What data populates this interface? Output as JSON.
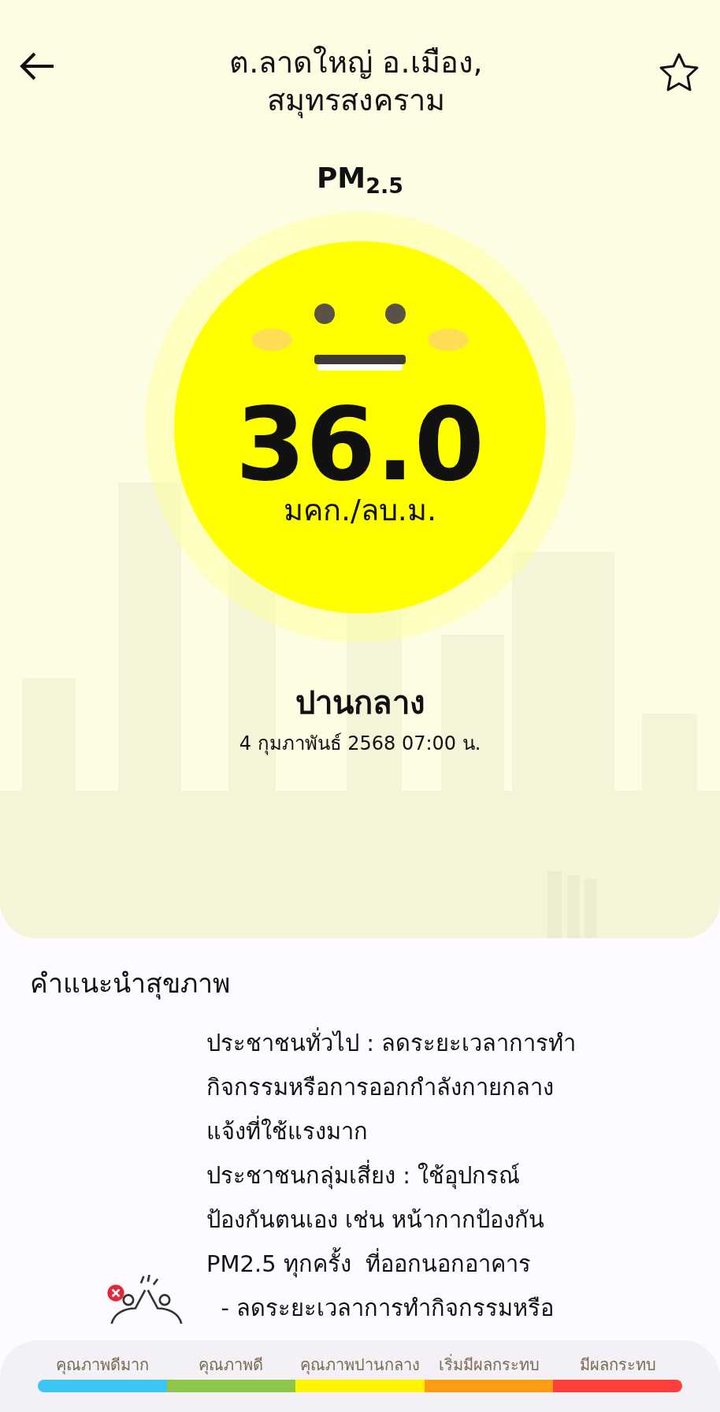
{
  "header": {
    "title_lines": [
      "ต.ลาดใหญ่ อ.เมือง,",
      "สมุทรสงคราม"
    ],
    "favorite": false
  },
  "pollutant": "PM$_{2.5}$",
  "reading": {
    "value": "36.0",
    "unit": "มคก./ลบ.ม.",
    "color": "#ffff00",
    "level_label": "ปานกลาง",
    "datetime": "4 กุมภาพันธ์ 2568  07:00 น."
  },
  "advice": {
    "heading": "คำแนะนำสุขภาพ",
    "paragraphs": [
      {
        "lines": [
          "ประชาชนทั่วไป : ลดระยะเวลาการทำ",
          "กิจกรรมหรือการออกกำลังกายกลาง",
          "แจ้งที่ใช้แรงมาก"
        ]
      },
      {
        "lines": [
          "ประชาชนกลุ่มเสี่ยง : ใช้อุปกรณ์",
          "ป้องกันตนเอง เช่น หน้ากากป้องกัน",
          "PM2.5 ทุกครั้ง  ที่ออกนอกอาคาร"
        ]
      },
      {
        "lines": [
          "  - ลดระยะเวลาการทำกิจกรรมหรือ"
        ]
      }
    ]
  },
  "legend": [
    {
      "label": "คุณภาพดีมาก",
      "color": "#3dc6f4"
    },
    {
      "label": "คุณภาพดี",
      "color": "#8ec64c"
    },
    {
      "label": "คุณภาพปานกลาง",
      "color": "#fff500"
    },
    {
      "label": "เริ่มมีผลกระทบ",
      "color": "#ff9d12"
    },
    {
      "label": "มีผลกระทบ",
      "color": "#ff3f3c"
    }
  ]
}
